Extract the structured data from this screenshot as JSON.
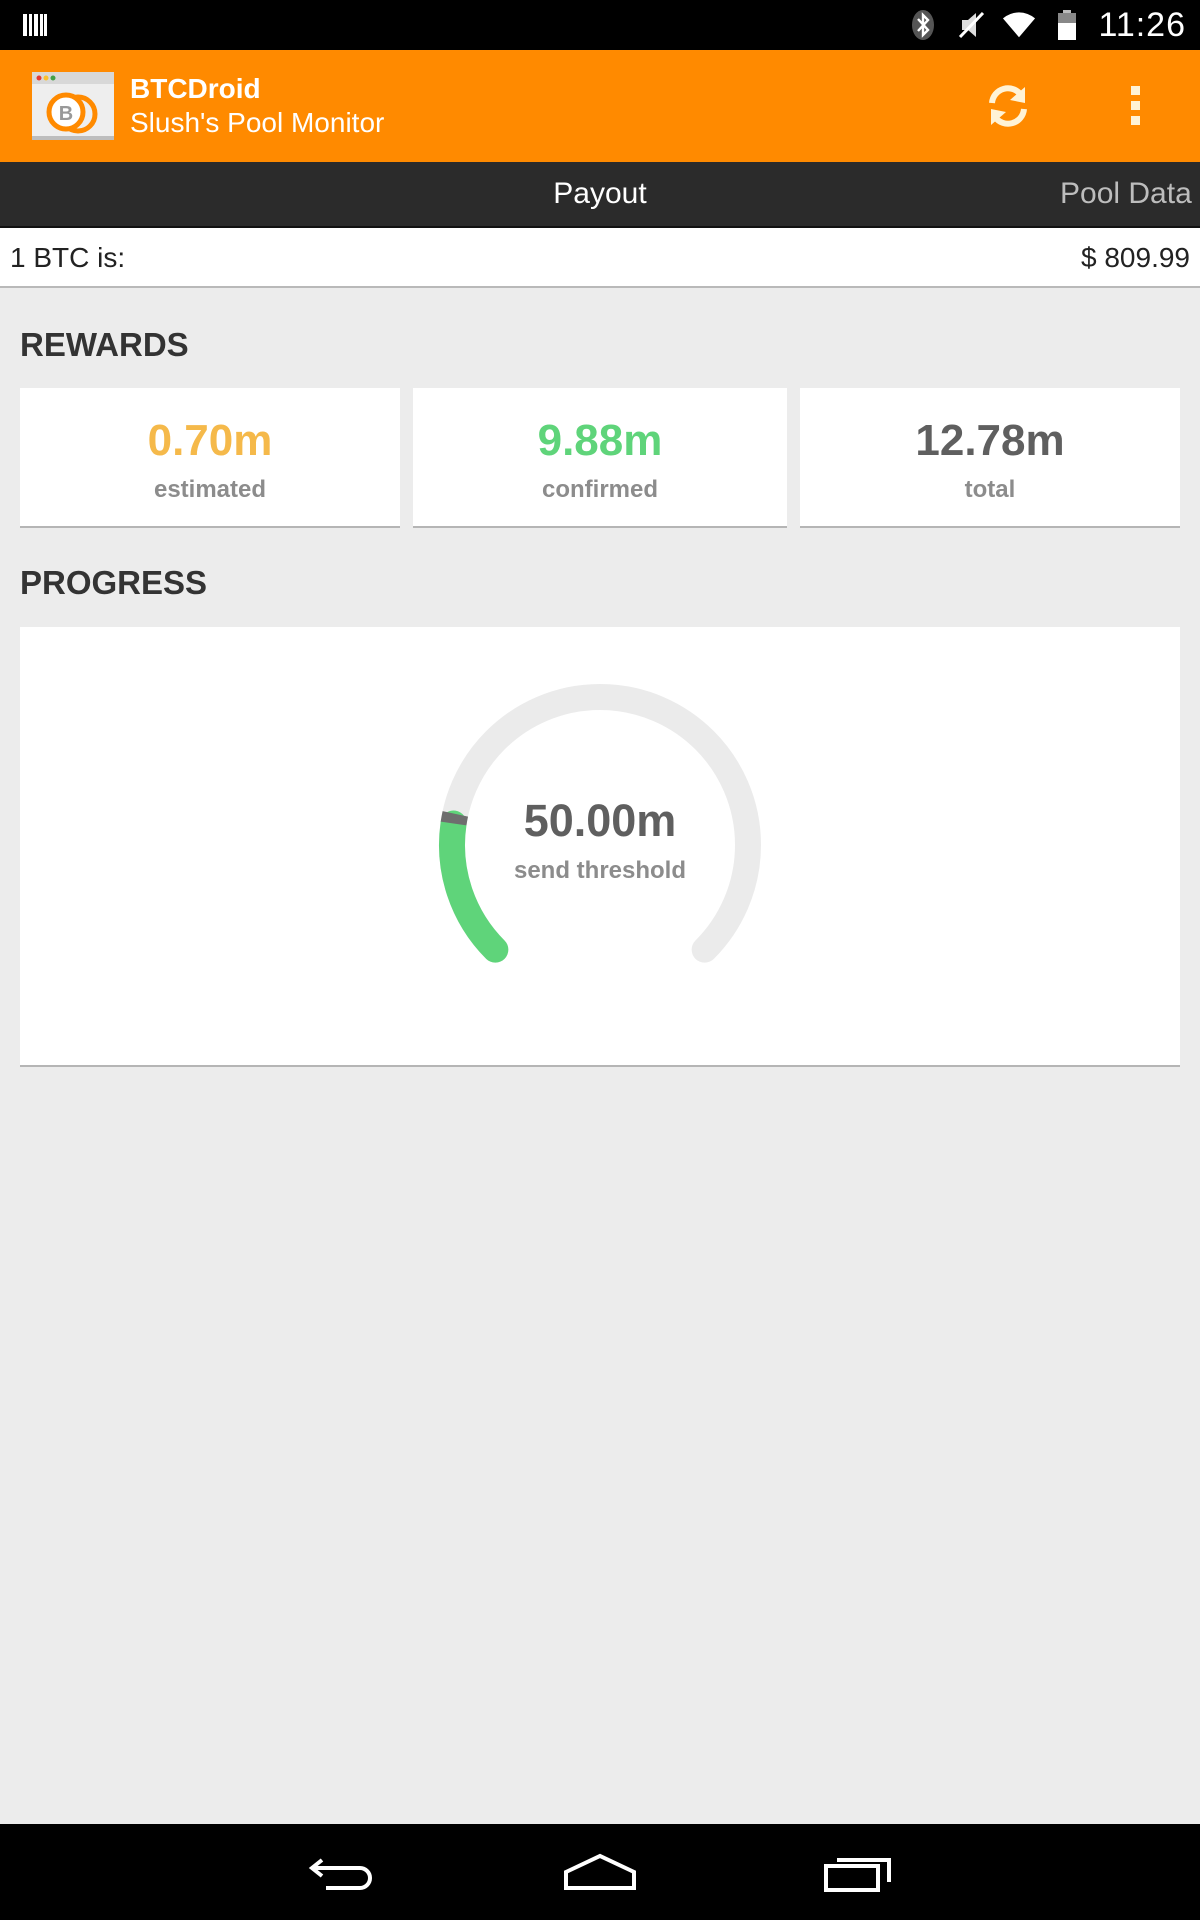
{
  "status_bar": {
    "time": "11:26",
    "icons": [
      "barcode-icon",
      "bluetooth-icon",
      "mute-icon",
      "wifi-icon",
      "battery-icon"
    ]
  },
  "action_bar": {
    "title": "BTCDroid",
    "subtitle": "Slush's Pool Monitor",
    "icons": [
      "app-logo-icon",
      "refresh-icon",
      "overflow-menu-icon"
    ],
    "background": "#ff8a00"
  },
  "tabs": [
    {
      "label": "Payout",
      "selected": true
    },
    {
      "label": "Pool Data",
      "selected": false
    }
  ],
  "price": {
    "label": "1 BTC is:",
    "value": "$ 809.99"
  },
  "rewards": {
    "title": "REWARDS",
    "cards": [
      {
        "value": "0.70m",
        "label": "estimated",
        "color": "#f5b94a"
      },
      {
        "value": "9.88m",
        "label": "confirmed",
        "color": "#5fd47a"
      },
      {
        "value": "12.78m",
        "label": "total",
        "color": "#5f5f5f"
      }
    ]
  },
  "progress": {
    "title": "PROGRESS",
    "threshold_value": "50.00m",
    "threshold_label": "send threshold",
    "confirmed_fraction": 0.1976,
    "estimated_fraction": 0.014,
    "colors": {
      "track": "#ebebeb",
      "confirmed": "#5fd47a",
      "estimated": "#6e6e6e"
    }
  },
  "nav_bar": {
    "icons": [
      "back-icon",
      "home-icon",
      "recents-icon"
    ]
  }
}
